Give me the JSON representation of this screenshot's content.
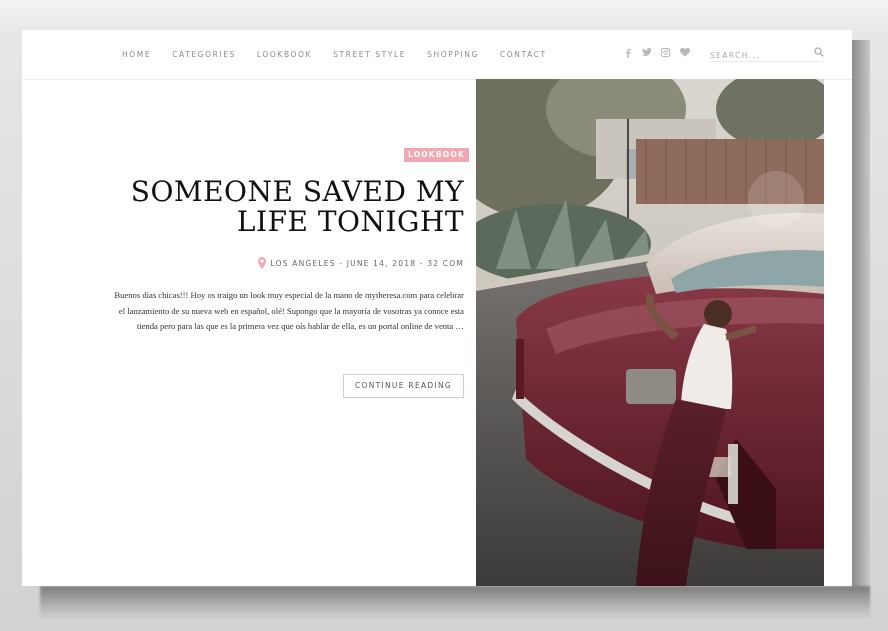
{
  "nav": {
    "items": [
      {
        "label": "HOME"
      },
      {
        "label": "CATEGORIES"
      },
      {
        "label": "LOOKBOOK"
      },
      {
        "label": "STREET STYLE"
      },
      {
        "label": "SHOPPING"
      },
      {
        "label": "CONTACT"
      }
    ]
  },
  "social": {
    "icons": [
      "facebook-icon",
      "twitter-icon",
      "instagram-icon",
      "heart-icon"
    ]
  },
  "search": {
    "placeholder": "SEARCH..."
  },
  "post": {
    "category": "LOOKBOOK",
    "title_line1": "SOMEONE SAVED MY",
    "title_line2": "LIFE TONIGHT",
    "meta": "LOS ANGELES - JUNE 14, 2018 - 32 COM",
    "excerpt": "Buenos días chicas!!! Hoy os traigo un look muy especial de la mano de mytheresa.com para celebrar el lanzamiento de su nueva web en español, olé! Supongo que la mayoría de vosotras ya conoce esta tienda pero para las que es la primera vez que oís hablar de ella, es un portal online de venta …",
    "read_more": "CONTINUE READING"
  },
  "colors": {
    "accent_pink": "#f1a8b0",
    "car_burgundy": "#6e2030",
    "text_dark": "#111111"
  }
}
